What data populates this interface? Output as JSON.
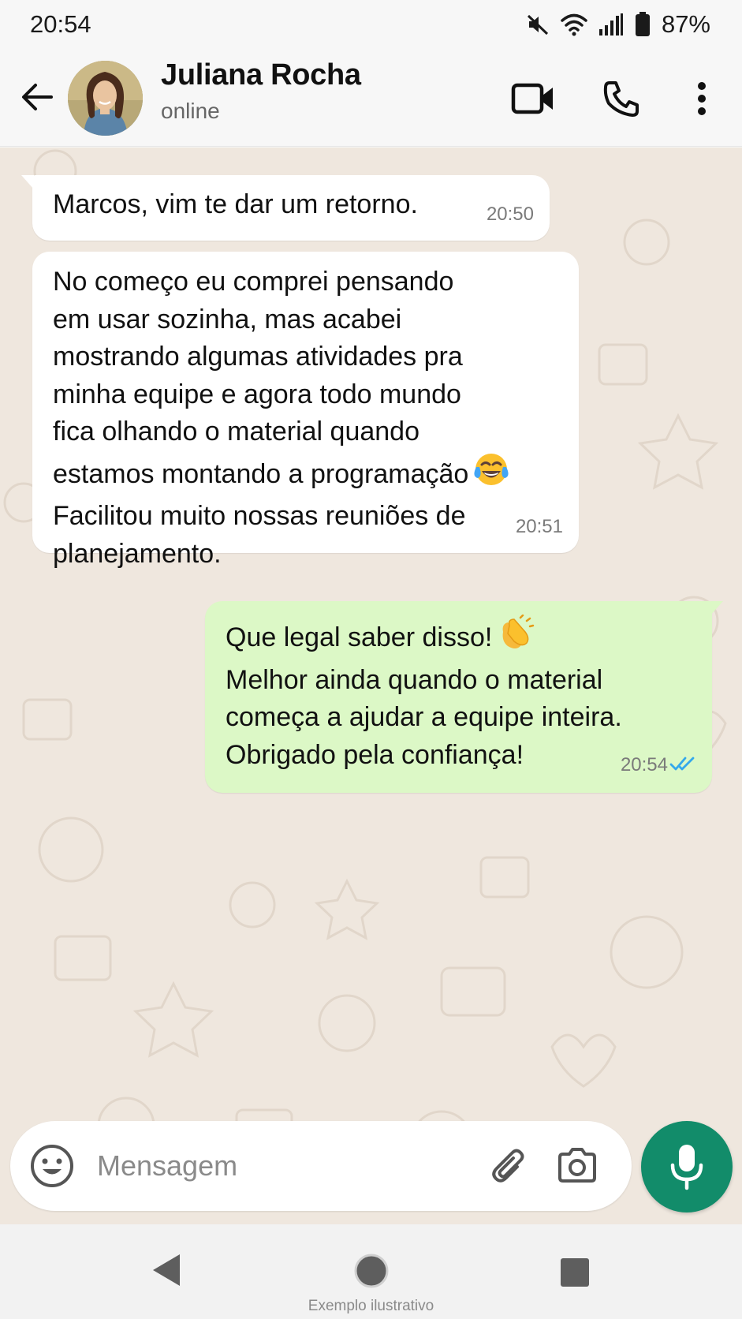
{
  "status_bar": {
    "time": "20:54",
    "battery": "87%",
    "icons": [
      "mute-icon",
      "wifi-icon",
      "signal-icon",
      "battery-icon"
    ]
  },
  "header": {
    "contact_name": "Juliana Rocha",
    "contact_status": "online",
    "icons": [
      "back-arrow-icon",
      "video-call-icon",
      "phone-call-icon",
      "more-vert-icon"
    ]
  },
  "messages": [
    {
      "direction": "incoming",
      "text": "Marcos, vim te dar um retorno.",
      "time": "20:50"
    },
    {
      "direction": "incoming",
      "text": "No começo eu comprei pensando\nem usar sozinha, mas acabei\nmostrando algumas atividades pra\nminha equipe e agora todo mundo\nfica olhando o material quando\nestamos montando a programação",
      "emoji": "tears-of-joy-emoji",
      "text_after_emoji": "Facilitou muito nossas reuniões de\nplanejamento.",
      "time": "20:51"
    },
    {
      "direction": "outgoing",
      "text": "Que legal saber disso!",
      "emoji": "clapping-hands-emoji",
      "text_after_emoji": "Melhor ainda quando o material\ncomeça a ajudar a equipe inteira.\nObrigado pela confiança!",
      "time": "20:54",
      "status": "read"
    }
  ],
  "input": {
    "placeholder": "Mensagem",
    "icons": [
      "emoji-icon",
      "attach-icon",
      "camera-icon",
      "mic-icon"
    ]
  },
  "nav": {
    "watermark": "Exemplo ilustrativo",
    "icons": [
      "nav-back-icon",
      "nav-home-icon",
      "nav-recents-icon"
    ]
  },
  "colors": {
    "chat_background": "#efe7de",
    "incoming_bubble": "#ffffff",
    "outgoing_bubble": "#dcf8c6",
    "accent": "#128c6a",
    "read_ticks": "#34a8eb"
  }
}
